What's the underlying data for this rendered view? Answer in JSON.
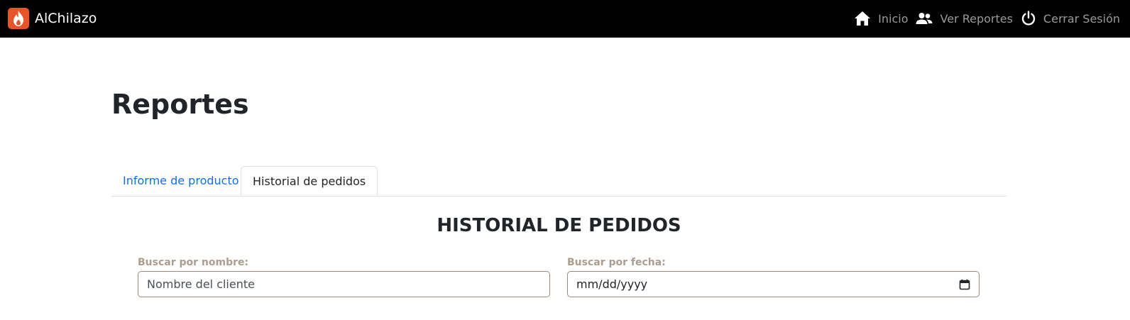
{
  "navbar": {
    "brand": "AlChilazo",
    "items": [
      {
        "label": "Inicio",
        "icon": "home-icon"
      },
      {
        "label": "Ver Reportes",
        "icon": "people-icon"
      },
      {
        "label": "Cerrar Sesión",
        "icon": "power-icon"
      }
    ]
  },
  "page": {
    "title": "Reportes"
  },
  "tabs": [
    {
      "label": "Informe de producto",
      "active": false
    },
    {
      "label": "Historial de pedidos",
      "active": true
    }
  ],
  "section": {
    "heading": "HISTORIAL DE PEDIDOS"
  },
  "filters": {
    "name_label": "Buscar por nombre:",
    "name_placeholder": "Nombre del cliente",
    "date_label": "Buscar por fecha:",
    "date_placeholder": "mm/dd/yyyy"
  },
  "colors": {
    "navbar_bg": "#000000",
    "brand_logo": "#e8542a",
    "tab_link": "#0d6efd",
    "label_color": "#ab9e8e"
  }
}
